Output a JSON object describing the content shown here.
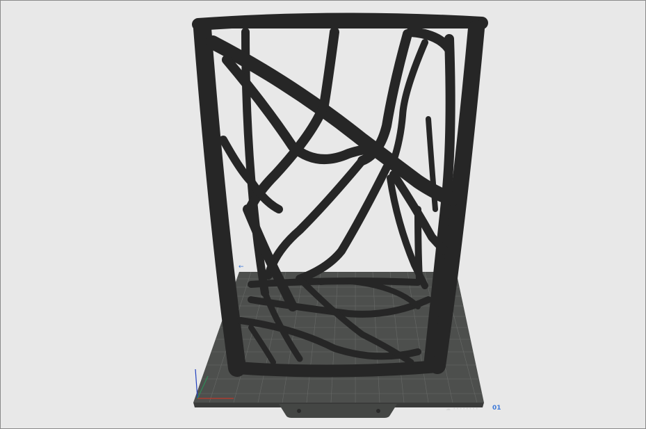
{
  "viewport": {
    "background": "#e8e8e8",
    "border_color": "#8a8a8a"
  },
  "model": {
    "name": "voronoi-lattice-vase",
    "color": "#262626"
  },
  "build_plate": {
    "color": "#4d4f4d",
    "grid_color": "#6a6c6a",
    "label": "☁ ••••••••",
    "plate_number": "01",
    "corner_mark": "←"
  },
  "axes": {
    "x_color": "#c0392b",
    "y_color": "#2e8b57",
    "z_color": "#1f3fbf"
  }
}
